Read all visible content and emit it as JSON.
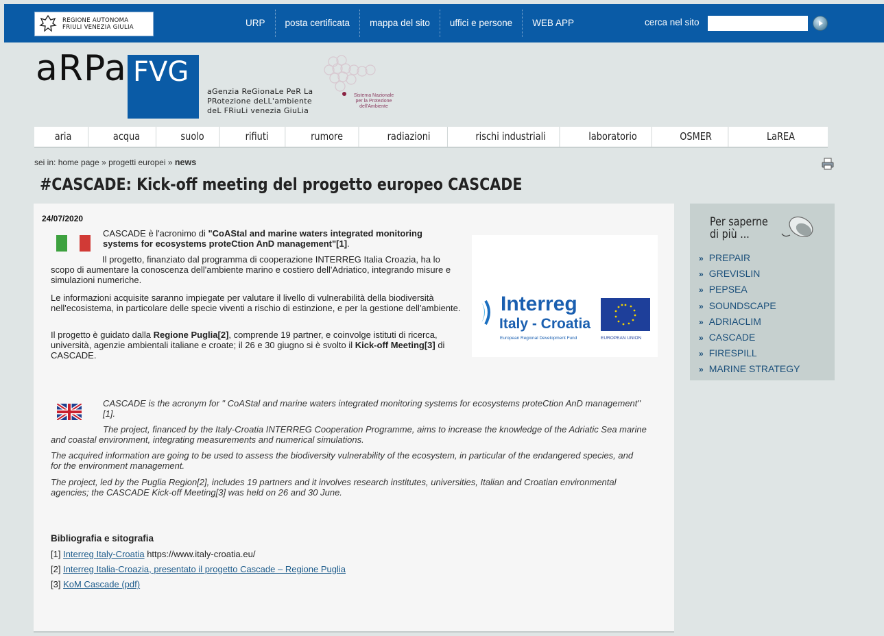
{
  "region_logo": {
    "line1": "REGIONE AUTONOMA",
    "line2": "FRIULI VENEZIA GIULIA"
  },
  "top_nav": [
    "URP",
    "posta certificata",
    "mappa del sito",
    "uffici e persone",
    "WEB APP"
  ],
  "search": {
    "label": "cerca nel sito",
    "value": ""
  },
  "brand": {
    "arpa": "aRPa",
    "fvg": "FVG",
    "agency_lines": [
      "aGenzia ReGionaLe PeR La",
      "PRotezione deLL'ambiente",
      "deL FRiuLi venezia GiuLia"
    ],
    "snpa_lines": [
      "Sistema Nazionale",
      "per la Protezione",
      "dell'Ambiente"
    ]
  },
  "main_nav": [
    "aria",
    "acqua",
    "suolo",
    "rifiuti",
    "rumore",
    "radiazioni",
    "rischi industriali",
    "laboratorio",
    "OSMER",
    "LaREA"
  ],
  "breadcrumb": {
    "home": "home page",
    "section": "progetti europei",
    "current": "news",
    "prefix": "sei in:",
    "sep": "»"
  },
  "page_title": "#CASCADE: Kick-off meeting del progetto europeo CASCADE",
  "article": {
    "date": "24/07/2020",
    "it_p1_start": "CASCADE è l'acronimo di ",
    "it_p1_bold": "\"CoAStal and marine waters integrated monitoring systems for ecosystems proteCtion AnD management\"[1]",
    "it_p1_end": ".",
    "it_p2": "Il progetto, finanziato dal programma di cooperazione INTERREG Italia Croazia, ha lo scopo di aumentare la conoscenza dell'ambiente marino e costiero dell'Adriatico, integrando misure e simulazioni numeriche.",
    "it_p3": "Le informazioni acquisite saranno impiegate per valutare il livello di vulnerabilità della biodiversità nell'ecosistema, in particolare delle specie viventi a rischio di estinzione, e per la gestione dell'ambiente.",
    "it_p4_a": "Il progetto è guidato dalla ",
    "it_p4_b": "Regione Puglia[2]",
    "it_p4_c": ", comprende 19 partner, e coinvolge istituti di ricerca, università, agenzie ambientali italiane e croate; il 26 e 30 giugno si è svolto il ",
    "it_p4_d": "Kick-off Meeting[3]",
    "it_p4_e": " di CASCADE.",
    "en_p1": "CASCADE is the acronym for \" CoAStal and marine waters integrated monitoring systems for ecosystems proteCtion AnD management\" [1].",
    "en_p2": "The project, financed by the Italy-Croatia INTERREG Cooperation Programme, aims to increase the knowledge of the Adriatic Sea marine and coastal environment, integrating measurements and numerical simulations.",
    "en_p3": "The acquired information are going to be used to assess the biodiversity vulnerability of the ecosystem, in particular of the endangered species, and for the environment management.",
    "en_p4": "The project, led by the Puglia Region[2], includes 19 partners and it involves research institutes, universities, Italian and Croatian environmental agencies; the CASCADE Kick-off Meeting[3] was held on 26 and 30 June.",
    "logo": {
      "word": "Interreg",
      "sub": "Italy - Croatia",
      "fund": "European Regional Development Fund",
      "eu": "EUROPEAN UNION"
    },
    "biblio_title": "Bibliografia e sitografia",
    "refs": [
      {
        "num": "[1]",
        "link": "Interreg Italy-Croatia",
        "extra": " https://www.italy-croatia.eu/"
      },
      {
        "num": "[2]",
        "link": "Interreg Italia-Croazia, presentato il progetto Cascade – Regione Puglia",
        "extra": ""
      },
      {
        "num": "[3]",
        "link": "KoM Cascade (pdf)",
        "extra": ""
      }
    ]
  },
  "side": {
    "title_line1": "Per saperne",
    "title_line2": "di più ...",
    "links": [
      "PREPAIR",
      "GREVISLIN",
      "PEPSEA",
      "SOUNDSCAPE",
      "ADRIACLIM",
      "CASCADE",
      "FIRESPILL",
      "MARINE STRATEGY"
    ]
  },
  "colors": {
    "brand_blue": "#0a5ba6",
    "background": "#dfe5e5",
    "side_panel": "#c6d0cf"
  }
}
